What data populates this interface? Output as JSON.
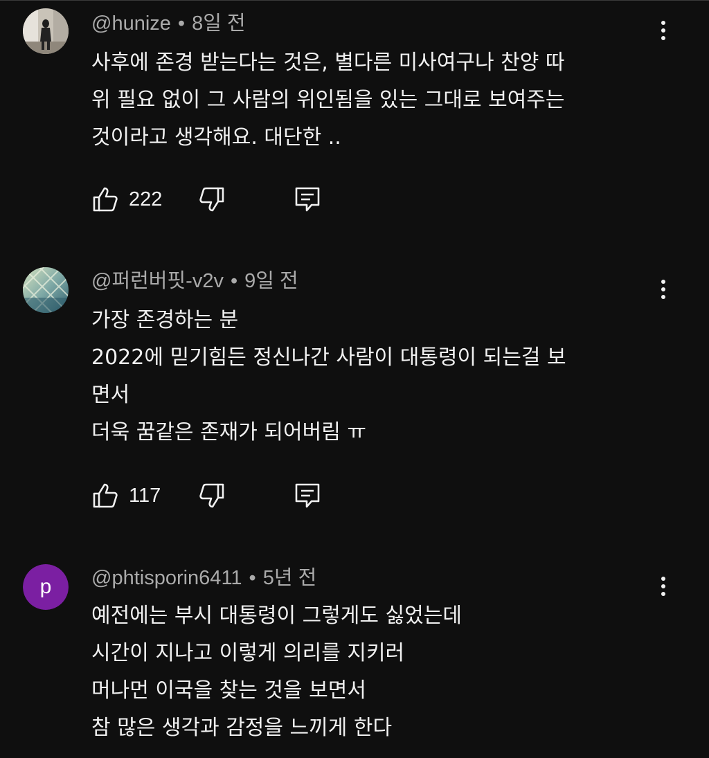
{
  "comments": [
    {
      "author": "@hunize",
      "time": "8일 전",
      "lines": [
        "사후에 존경 받는다는 것은, 별다른 미사여구나 찬양 따",
        "위 필요 없이 그 사람의 위인됨을 있는 그대로 보여주는",
        "것이라고 생각해요. 대단한 .."
      ],
      "likes": "222",
      "avatar_type": "photo"
    },
    {
      "author": "@퍼런버핏-v2v",
      "time": "9일 전",
      "lines": [
        "가장 존경하는 분",
        "2022에 믿기힘든 정신나간 사람이 대통령이 되는걸 보",
        "면서",
        "더욱 꿈같은 존재가 되어버림 ㅠ"
      ],
      "likes": "117",
      "avatar_type": "pattern"
    },
    {
      "author": "@phtisporin6411",
      "time": "5년 전",
      "lines": [
        "예전에는 부시 대통령이 그렇게도 싫었는데",
        "시간이 지나고 이렇게 의리를 지키러",
        "머나먼 이국을 찾는 것을 보면서",
        "참 많은 생각과 감정을 느끼게 한다"
      ],
      "avatar_letter": "p",
      "avatar_color": "#7b1fa2",
      "avatar_type": "letter"
    }
  ],
  "separator": "•",
  "icons": {
    "like": "thumb-up-icon",
    "dislike": "thumb-down-icon",
    "reply": "reply-comment-icon",
    "more": "more-vertical-icon"
  }
}
